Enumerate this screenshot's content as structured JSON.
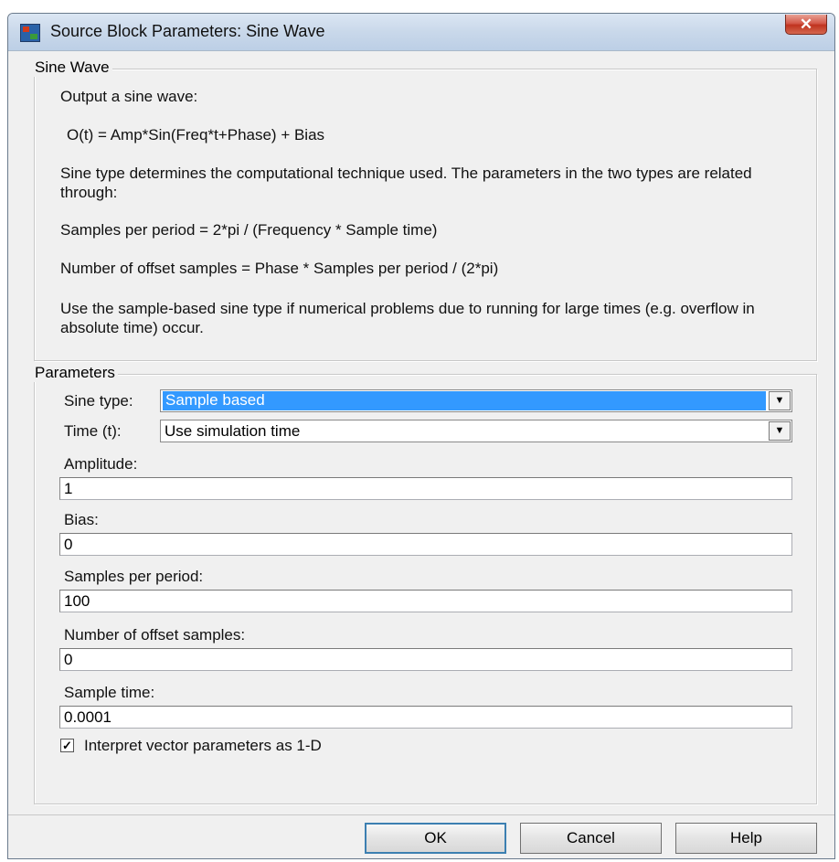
{
  "window": {
    "title": "Source Block Parameters: Sine Wave",
    "close_glyph": "✕"
  },
  "description": {
    "group_title": "Sine Wave",
    "paragraphs": [
      "Output a sine wave:",
      "O(t) = Amp*Sin(Freq*t+Phase) + Bias",
      "Sine type determines the computational technique used. The parameters in the two types are related through:",
      "Samples per period = 2*pi / (Frequency * Sample time)",
      "Number of offset samples = Phase * Samples per period / (2*pi)",
      "Use the sample-based sine type if numerical problems due to running for large times (e.g. overflow in absolute time) occur."
    ]
  },
  "parameters": {
    "group_title": "Parameters",
    "sine_type": {
      "label": "Sine type:",
      "value": "Sample based"
    },
    "time": {
      "label": "Time (t):",
      "value": "Use simulation time"
    },
    "amplitude": {
      "label": "Amplitude:",
      "value": "1"
    },
    "bias": {
      "label": "Bias:",
      "value": "0"
    },
    "samples_per_period": {
      "label": "Samples per period:",
      "value": "100"
    },
    "offset_samples": {
      "label": "Number of offset samples:",
      "value": "0"
    },
    "sample_time": {
      "label": "Sample time:",
      "value": "0.0001"
    },
    "interpret_vector": {
      "label": "Interpret vector parameters as 1-D",
      "checked": true,
      "glyph": "✓"
    }
  },
  "buttons": {
    "ok": "OK",
    "cancel": "Cancel",
    "help": "Help"
  },
  "icons": {
    "dropdown_arrow": "▼"
  }
}
